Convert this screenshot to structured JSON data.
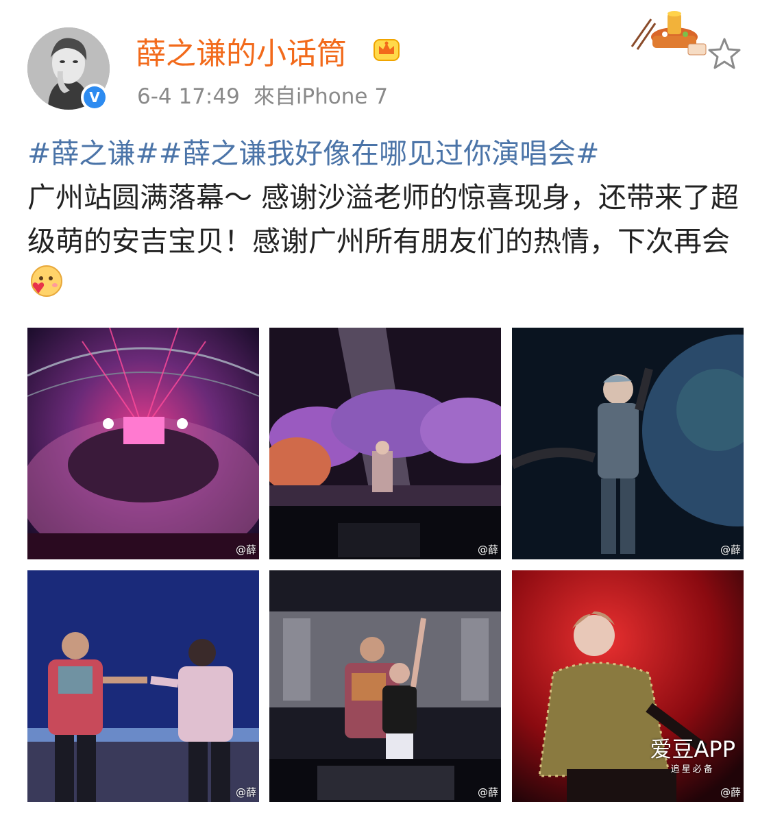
{
  "post": {
    "username": "薛之谦的小话筒",
    "timestamp": "6-4 17:49",
    "source": "來自iPhone 7",
    "hashtag1": "#薛之谦#",
    "hashtag2": "#薛之谦我好像在哪见过你演唱会#",
    "body_text": "广州站圆满落幕～  感谢沙溢老师的惊喜现身，还带来了超级萌的安吉宝贝！感谢广州所有朋友们的热情，下次再会",
    "verified_badge": "V"
  },
  "icons": {
    "avatar": "avatar-photo",
    "crown": "crown-icon",
    "decoration": "hotpot-icon",
    "favorite": "star-icon",
    "emoji": "blush-heart-emoji-icon"
  },
  "photos": [
    {
      "watermark": "@薛",
      "alt": "arena-overview"
    },
    {
      "watermark": "@薛",
      "alt": "stage-purple-trees"
    },
    {
      "watermark": "@薛",
      "alt": "singer-planet"
    },
    {
      "watermark": "@薛",
      "alt": "duet-hands"
    },
    {
      "watermark": "@薛",
      "alt": "father-and-son"
    },
    {
      "watermark": "@薛",
      "alt": "singer-red-stage"
    }
  ],
  "app_watermark": {
    "name": "爱豆APP",
    "tagline": "追星必备"
  },
  "colors": {
    "username": "#f26a1b",
    "hashtag": "#4b74a8",
    "meta": "#8a8a8a",
    "text": "#222222",
    "verified": "#2d8bf0"
  }
}
